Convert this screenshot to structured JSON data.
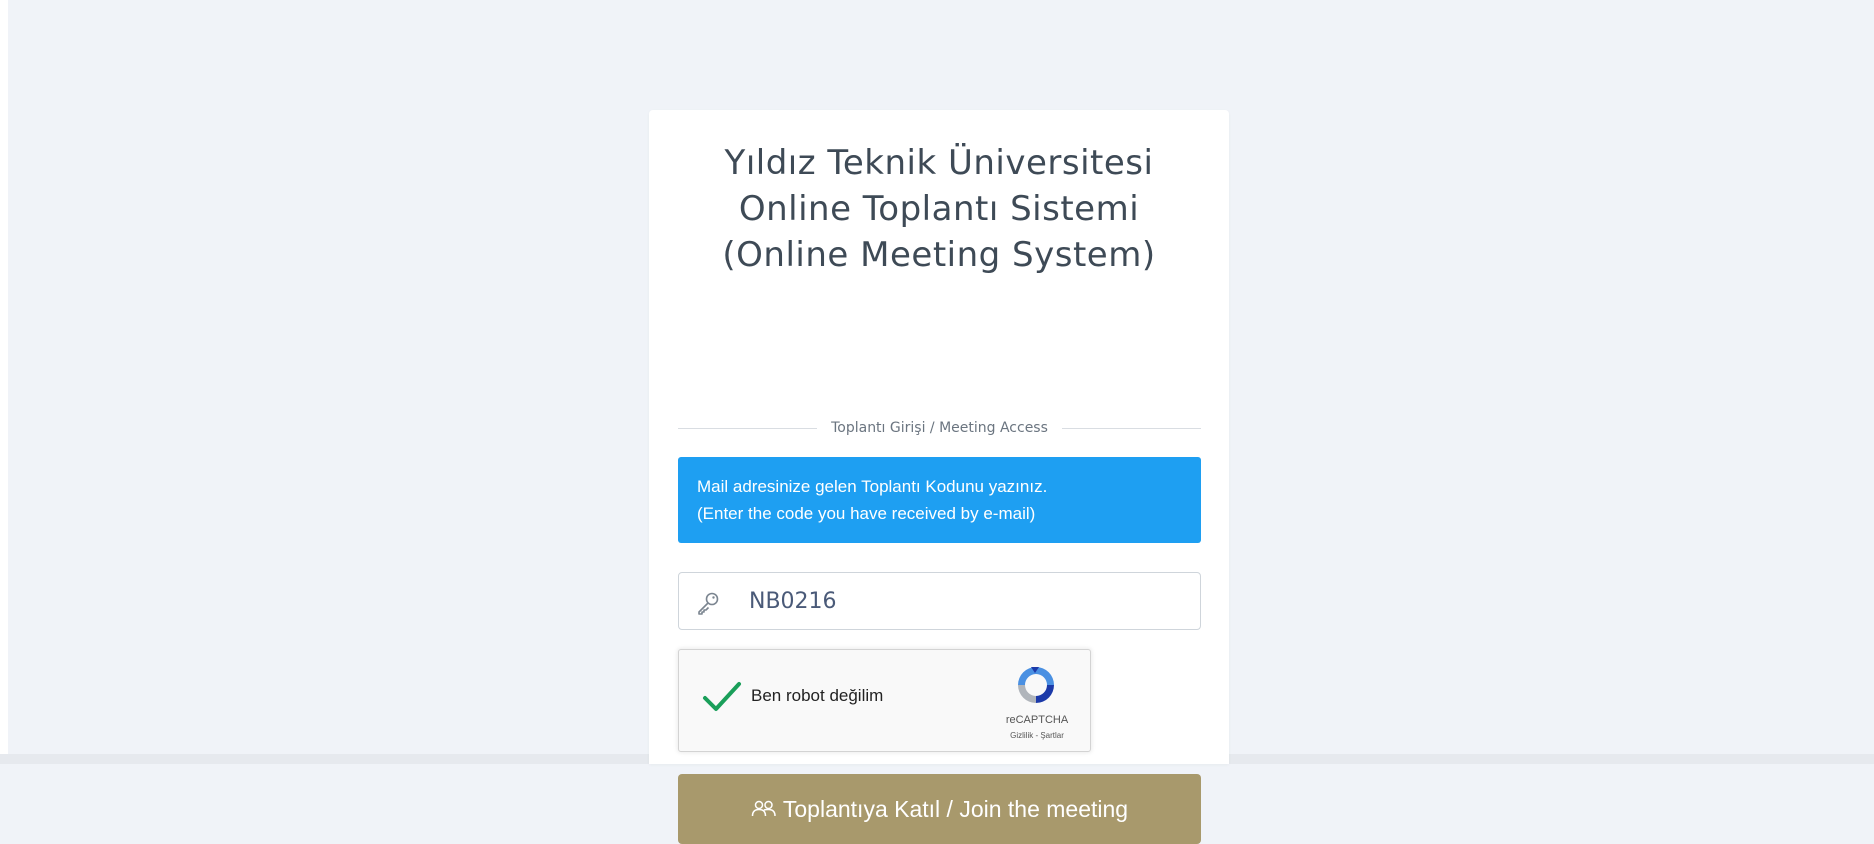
{
  "header": {
    "title_lines": [
      "Yıldız Teknik Üniversitesi",
      "Online Toplantı Sistemi",
      "(Online Meeting System)"
    ]
  },
  "divider": {
    "label": "Toplantı Girişi / Meeting Access"
  },
  "info": {
    "lines": [
      "Mail adresinize gelen Toplantı Kodunu yazınız.",
      "(Enter the code you have received by e-mail)"
    ],
    "color": "#1e9ff2"
  },
  "code_input": {
    "value": "NB0216",
    "icon": "key-icon"
  },
  "recaptcha": {
    "label": "Ben robot değilim",
    "checked": true,
    "brand": "reCAPTCHA",
    "links": "Gizlilik - Şartlar",
    "check_color": "#1a9f5a"
  },
  "join_button": {
    "label": "Toplantıya Katıl / Join the meeting",
    "icon": "users-icon",
    "color": "#a8996c"
  },
  "colors": {
    "background": "#f0f3f8",
    "card": "#ffffff",
    "title_text": "#3e4a56"
  }
}
